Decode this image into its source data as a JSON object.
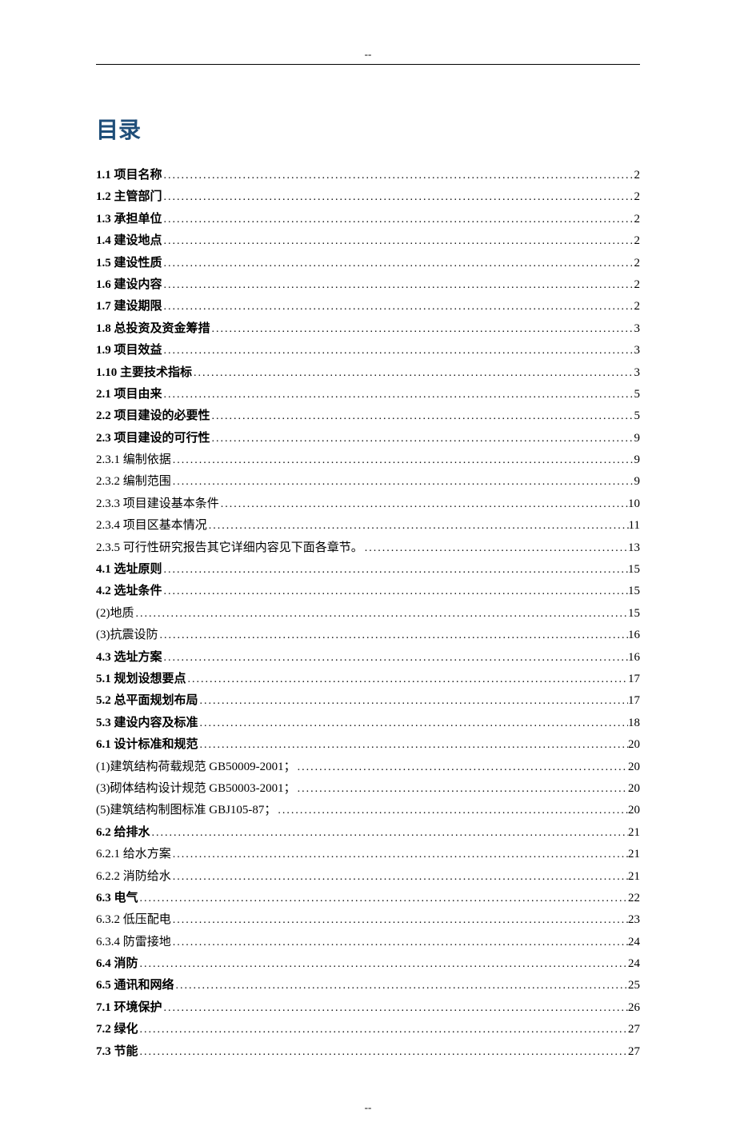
{
  "header_mark": "--",
  "footer_mark": "--",
  "title": "目录",
  "toc": [
    {
      "label": "1.1 项目名称",
      "page": "2",
      "bold": true
    },
    {
      "label": "1.2 主管部门",
      "page": "2",
      "bold": true
    },
    {
      "label": "1.3 承担单位",
      "page": "2",
      "bold": true
    },
    {
      "label": "1.4 建设地点",
      "page": "2",
      "bold": true
    },
    {
      "label": "1.5 建设性质",
      "page": "2",
      "bold": true
    },
    {
      "label": "1.6 建设内容",
      "page": "2",
      "bold": true
    },
    {
      "label": "1.7 建设期限",
      "page": "2",
      "bold": true
    },
    {
      "label": "1.8 总投资及资金筹措",
      "page": "3",
      "bold": true
    },
    {
      "label": "1.9 项目效益",
      "page": "3",
      "bold": true
    },
    {
      "label": "1.10 主要技术指标",
      "page": "3",
      "bold": true
    },
    {
      "label": "2.1 项目由来",
      "page": "5",
      "bold": true
    },
    {
      "label": "2.2 项目建设的必要性",
      "page": "5",
      "bold": true
    },
    {
      "label": "2.3 项目建设的可行性",
      "page": "9",
      "bold": true
    },
    {
      "label": "2.3.1 编制依据",
      "page": "9",
      "bold": false
    },
    {
      "label": "2.3.2 编制范围",
      "page": "9",
      "bold": false
    },
    {
      "label": "2.3.3 项目建设基本条件",
      "page": "10",
      "bold": false
    },
    {
      "label": "2.3.4 项目区基本情况",
      "page": "11",
      "bold": false
    },
    {
      "label": "2.3.5 可行性研究报告其它详细内容见下面各章节。",
      "page": "13",
      "bold": false
    },
    {
      "label": "4.1 选址原则",
      "page": "15",
      "bold": true
    },
    {
      "label": "4.2 选址条件",
      "page": "15",
      "bold": true
    },
    {
      "label": "(2)地质",
      "page": "15",
      "bold": false
    },
    {
      "label": "(3)抗震设防",
      "page": "16",
      "bold": false
    },
    {
      "label": "4.3 选址方案",
      "page": "16",
      "bold": true
    },
    {
      "label": "5.1 规划设想要点",
      "page": "17",
      "bold": true
    },
    {
      "label": "5.2 总平面规划布局",
      "page": "17",
      "bold": true
    },
    {
      "label": "5.3 建设内容及标准",
      "page": "18",
      "bold": true
    },
    {
      "label": "6.1 设计标准和规范",
      "page": "20",
      "bold": true
    },
    {
      "label": "(1)建筑结构荷载规范 GB50009-2001；",
      "page": "20",
      "bold": false
    },
    {
      "label": "(3)砌体结构设计规范 GB50003-2001；",
      "page": "20",
      "bold": false
    },
    {
      "label": "(5)建筑结构制图标准 GBJ105-87；",
      "page": "20",
      "bold": false
    },
    {
      "label": "6.2 给排水",
      "page": "21",
      "bold": true
    },
    {
      "label": "6.2.1 给水方案",
      "page": "21",
      "bold": false
    },
    {
      "label": "6.2.2 消防给水",
      "page": "21",
      "bold": false
    },
    {
      "label": "6.3 电气",
      "page": "22",
      "bold": true
    },
    {
      "label": "6.3.2 低压配电",
      "page": "23",
      "bold": false
    },
    {
      "label": "6.3.4 防雷接地",
      "page": "24",
      "bold": false
    },
    {
      "label": "6.4 消防",
      "page": "24",
      "bold": true
    },
    {
      "label": "6.5 通讯和网络",
      "page": "25",
      "bold": true
    },
    {
      "label": "7.1 环境保护",
      "page": "26",
      "bold": true
    },
    {
      "label": "7.2 绿化",
      "page": "27",
      "bold": true
    },
    {
      "label": "7.3 节能",
      "page": "27",
      "bold": true
    }
  ]
}
